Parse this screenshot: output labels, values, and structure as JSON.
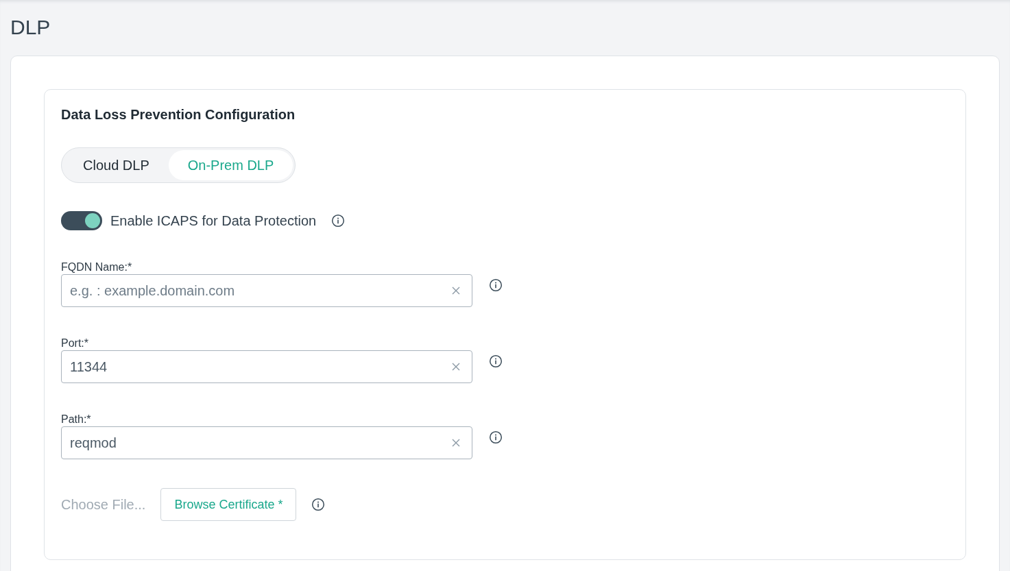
{
  "page": {
    "title": "DLP"
  },
  "section": {
    "title": "Data Loss Prevention Configuration"
  },
  "tabs": [
    {
      "label": "Cloud DLP",
      "selected": false
    },
    {
      "label": "On-Prem DLP",
      "selected": true
    }
  ],
  "toggle": {
    "label": "Enable ICAPS for Data Protection",
    "on": true
  },
  "fields": [
    {
      "label": "FQDN Name:*",
      "placeholder": "e.g. : example.domain.com"
    },
    {
      "label": "Port:*",
      "value": "11344"
    },
    {
      "label": "Path:*",
      "value": "reqmod"
    }
  ],
  "file": {
    "placeholder": "Choose File...",
    "button": "Browse Certificate *"
  }
}
